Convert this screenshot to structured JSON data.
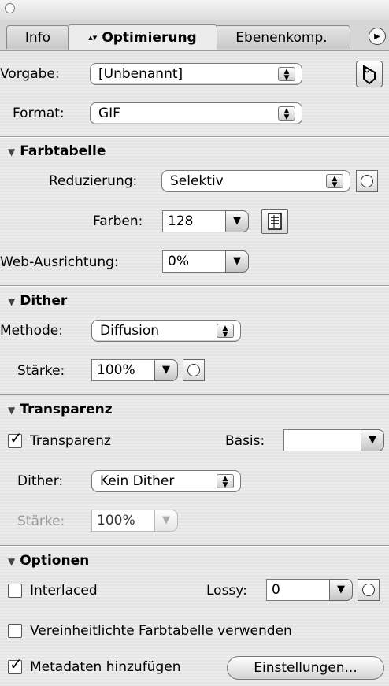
{
  "tabs": [
    {
      "label": "Info"
    },
    {
      "label": "Optimierung",
      "active": true
    },
    {
      "label": "Ebenenkomp."
    }
  ],
  "vorgabe": {
    "label": "Vorgabe:",
    "value": "[Unbenannt]"
  },
  "format": {
    "label": "Format:",
    "value": "GIF"
  },
  "farbtabelle": {
    "title": "Farbtabelle",
    "reduzierung_label": "Reduzierung:",
    "reduzierung_value": "Selektiv",
    "farben_label": "Farben:",
    "farben_value": "128",
    "web_label": "Web-Ausrichtung:",
    "web_value": "0%"
  },
  "dither": {
    "title": "Dither",
    "methode_label": "Methode:",
    "methode_value": "Diffusion",
    "staerke_label": "Stärke:",
    "staerke_value": "100%"
  },
  "transparenz": {
    "title": "Transparenz",
    "checkbox_label": "Transparenz",
    "checked": true,
    "basis_label": "Basis:",
    "basis_value": "",
    "dither_label": "Dither:",
    "dither_value": "Kein Dither",
    "staerke_label": "Stärke:",
    "staerke_value": "100%"
  },
  "optionen": {
    "title": "Optionen",
    "interlaced_label": "Interlaced",
    "interlaced_checked": false,
    "lossy_label": "Lossy:",
    "lossy_value": "0",
    "vereinheitlicht_label": "Vereinheitlichte Farbtabelle verwenden",
    "vereinheitlicht_checked": false,
    "metadaten_label": "Metadaten hinzufügen",
    "metadaten_checked": true,
    "einstellungen_label": "Einstellungen..."
  }
}
